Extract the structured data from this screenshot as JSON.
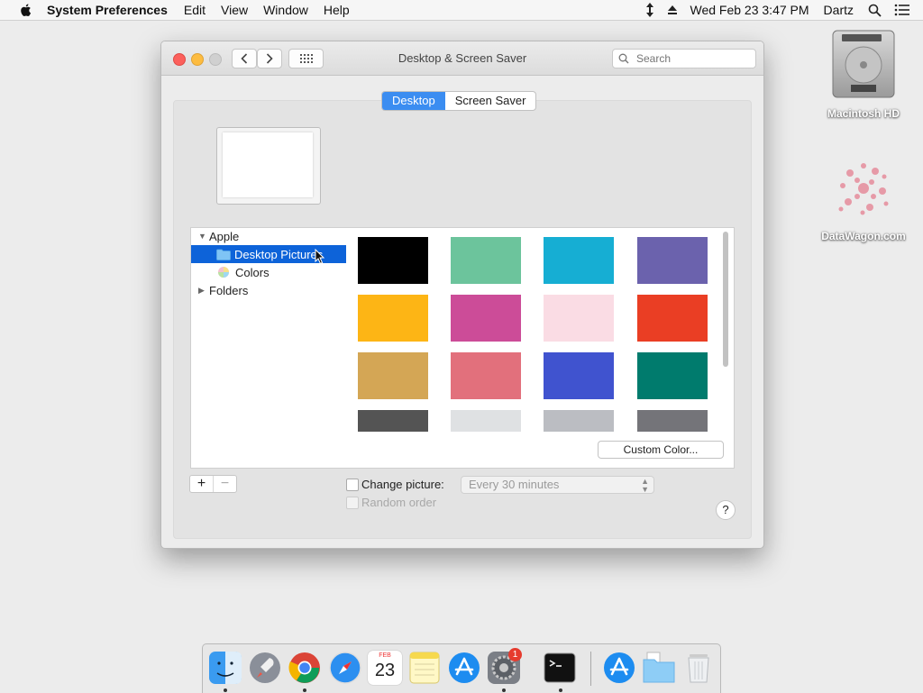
{
  "menubar": {
    "app_name": "System Preferences",
    "items": [
      "Edit",
      "View",
      "Window",
      "Help"
    ],
    "clock": "Wed Feb 23  3:47 PM",
    "user": "Dartz"
  },
  "desktop": {
    "icons": [
      {
        "label": "Macintosh HD",
        "icon": "hard-drive-icon"
      },
      {
        "label": "DataWagon.com",
        "icon": "pink-flower-file-icon"
      }
    ]
  },
  "window": {
    "title": "Desktop & Screen Saver",
    "search_placeholder": "Search",
    "tabs": [
      {
        "label": "Desktop",
        "active": true
      },
      {
        "label": "Screen Saver",
        "active": false
      }
    ],
    "source_list": {
      "items": [
        {
          "label": "Apple",
          "expanded": true,
          "indent": 0
        },
        {
          "label": "Desktop Pictures",
          "selected": true,
          "indent": 1,
          "icon": "folder-icon"
        },
        {
          "label": "Colors",
          "selected": false,
          "indent": 1,
          "icon": "color-wheel-icon"
        },
        {
          "label": "Folders",
          "expanded": false,
          "indent": 0
        }
      ]
    },
    "swatches": [
      "#000000",
      "#6cc49c",
      "#16aed3",
      "#6b62ad",
      "#fdb515",
      "#cc4c98",
      "#fadce4",
      "#ea3e24",
      "#d4a655",
      "#e2707c",
      "#4053cf",
      "#007b6d",
      "#545454",
      "#dfe1e3",
      "#bbbdc2",
      "#747479"
    ],
    "custom_color_label": "Custom Color...",
    "change_picture_label": "Change picture:",
    "change_picture_interval": "Every 30 minutes",
    "random_order_label": "Random order",
    "help_label": "?"
  },
  "dock": {
    "calendar_month": "FEB",
    "calendar_day": "23",
    "badge": "1"
  }
}
